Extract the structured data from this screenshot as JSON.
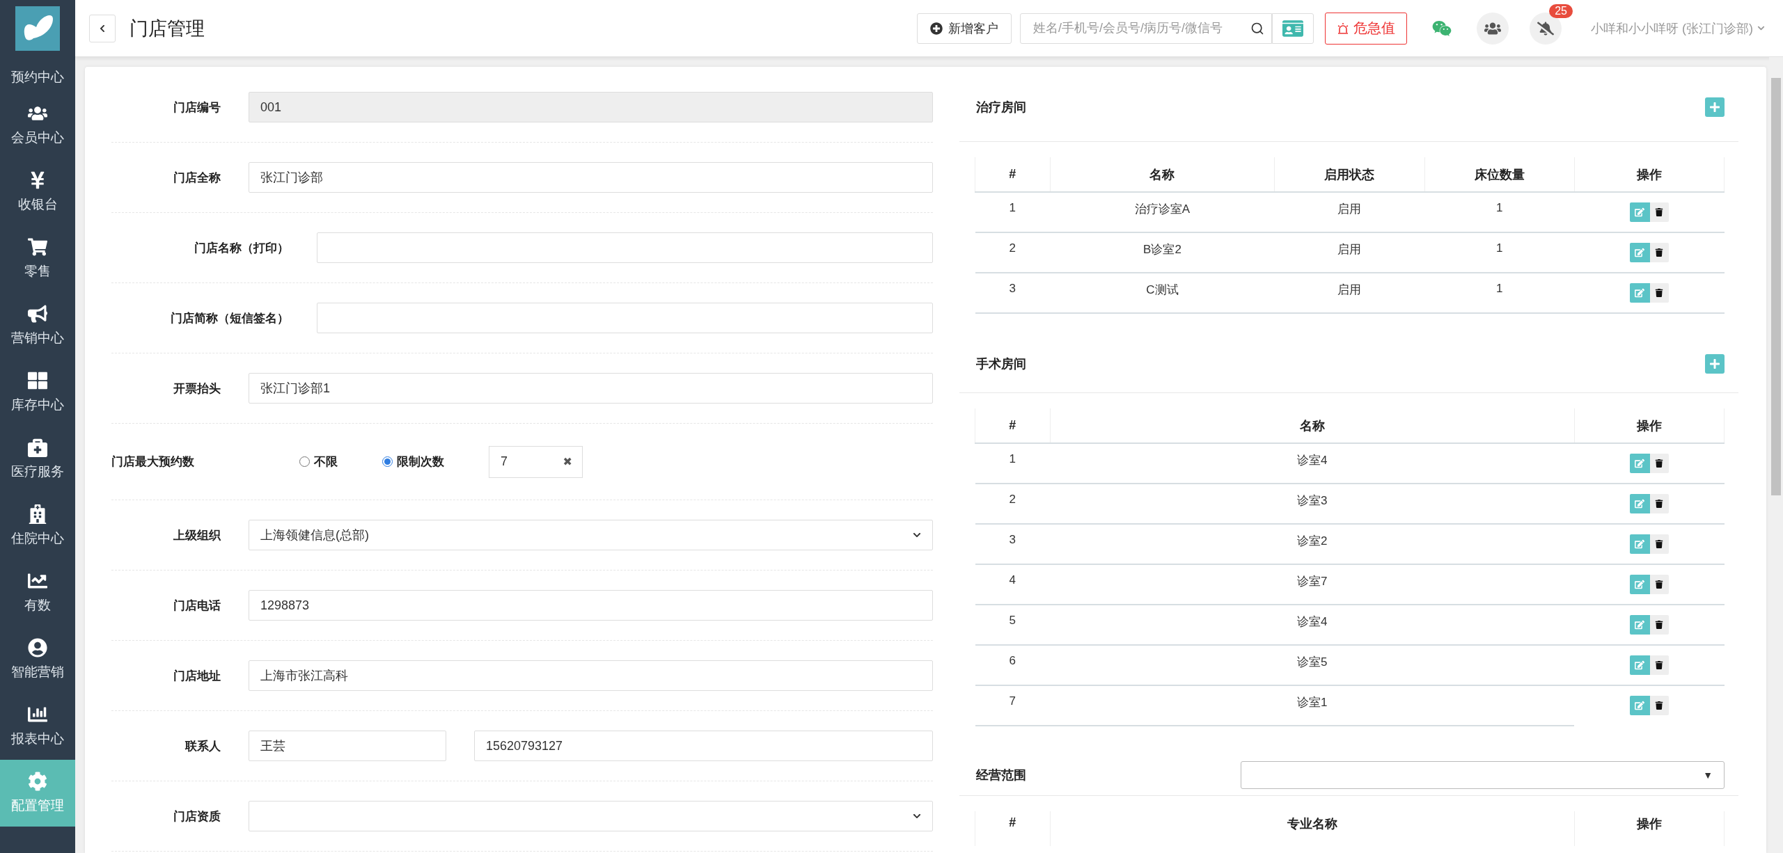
{
  "sidebar": {
    "items": [
      {
        "label": "预约中心",
        "selected": false
      },
      {
        "label": "会员中心",
        "selected": false
      },
      {
        "label": "收银台",
        "selected": false
      },
      {
        "label": "零售",
        "selected": false
      },
      {
        "label": "营销中心",
        "selected": false
      },
      {
        "label": "库存中心",
        "selected": false
      },
      {
        "label": "医疗服务",
        "selected": false
      },
      {
        "label": "住院中心",
        "selected": false
      },
      {
        "label": "有数",
        "selected": false
      },
      {
        "label": "智能营销",
        "selected": false
      },
      {
        "label": "报表中心",
        "selected": false
      },
      {
        "label": "配置管理",
        "selected": true
      }
    ]
  },
  "header": {
    "title": "门店管理",
    "new_customer": "新增客户",
    "search": {
      "placeholder": "姓名/手机号/会员号/病历号/微信号"
    },
    "alert_button": "危急值",
    "notification_count": "25",
    "user": "小咩和小小咩呀 (张江门诊部)"
  },
  "form": {
    "rows": [
      {
        "kind": "readonly",
        "label": "门店编号",
        "value": "001"
      },
      {
        "kind": "input",
        "label": "门店全称",
        "value": "张江门诊部"
      },
      {
        "kind": "input-indented",
        "label": "门店名称（打印）"
      },
      {
        "kind": "input-indented",
        "label": "门店简称（短信签名）"
      },
      {
        "kind": "input",
        "label": "开票抬头",
        "value": "张江门诊部1"
      },
      {
        "kind": "radio",
        "label": "门店最大预约数",
        "options": [
          {
            "label": "不限",
            "selected": false
          },
          {
            "label": "限制次数",
            "selected": true
          }
        ],
        "value": "7",
        "clear": "✖"
      },
      {
        "kind": "select",
        "label": "上级组织",
        "value": "上海领健信息(总部)"
      },
      {
        "kind": "input",
        "label": "门店电话",
        "value": "1298873"
      },
      {
        "kind": "input",
        "label": "门店地址",
        "value": "上海市张江高科"
      },
      {
        "kind": "pair",
        "label": "联系人",
        "value": "王芸",
        "value_2": "15620793127"
      },
      {
        "kind": "select",
        "label": "门店资质"
      }
    ]
  },
  "treatment_rooms": {
    "title": "治疗房间",
    "columns": [
      "#",
      "名称",
      "启用状态",
      "床位数量",
      "操作"
    ],
    "rows": [
      [
        "1",
        "治疗诊室A",
        "启用",
        "1"
      ],
      [
        "2",
        "B诊室2",
        "启用",
        "1"
      ],
      [
        "3",
        "C测试",
        "启用",
        "1"
      ]
    ]
  },
  "surgery_rooms": {
    "title": "手术房间",
    "columns": [
      "#",
      "名称",
      "操作"
    ],
    "rows": [
      [
        "1",
        "诊室4"
      ],
      [
        "2",
        "诊室3"
      ],
      [
        "3",
        "诊室2"
      ],
      [
        "4",
        "诊室7"
      ],
      [
        "5",
        "诊室4"
      ],
      [
        "6",
        "诊室5"
      ],
      [
        "7",
        "诊室1"
      ]
    ]
  },
  "business_scope": {
    "title": "经营范围",
    "dropdown_arrow": "▼",
    "columns": [
      "#",
      "专业名称",
      "操作"
    ]
  }
}
